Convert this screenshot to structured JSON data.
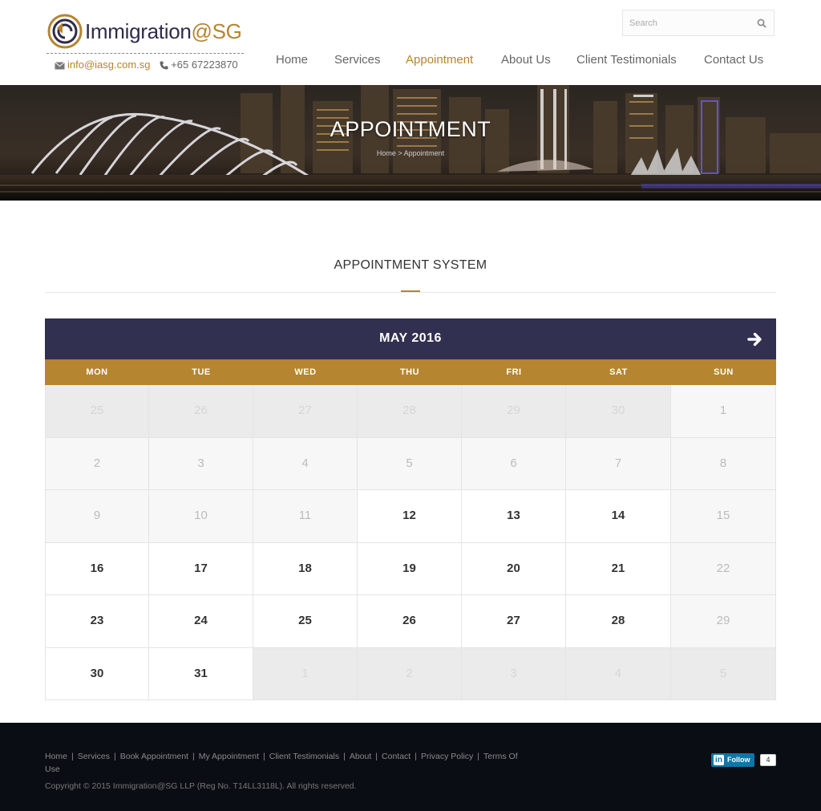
{
  "brand": {
    "name_main": "Immigration",
    "name_at": "@",
    "name_sg": "SG",
    "email": "info@iasg.com.sg",
    "phone": "+65 67223870"
  },
  "search": {
    "placeholder": "Search"
  },
  "nav": {
    "items": [
      {
        "label": "Home",
        "active": false
      },
      {
        "label": "Services",
        "active": false
      },
      {
        "label": "Appointment",
        "active": true
      },
      {
        "label": "About Us",
        "active": false
      },
      {
        "label": "Client Testimonials",
        "active": false
      },
      {
        "label": "Contact Us",
        "active": false
      }
    ]
  },
  "banner": {
    "title": "APPOINTMENT",
    "breadcrumb": "Home > Appointment"
  },
  "section": {
    "title": "APPOINTMENT SYSTEM"
  },
  "calendar": {
    "month_label": "MAY 2016",
    "weekdays": [
      "MON",
      "TUE",
      "WED",
      "THU",
      "FRI",
      "SAT",
      "SUN"
    ],
    "weeks": [
      [
        {
          "d": "25",
          "s": "other"
        },
        {
          "d": "26",
          "s": "other"
        },
        {
          "d": "27",
          "s": "other"
        },
        {
          "d": "28",
          "s": "other"
        },
        {
          "d": "29",
          "s": "other"
        },
        {
          "d": "30",
          "s": "other"
        },
        {
          "d": "1",
          "s": "past"
        }
      ],
      [
        {
          "d": "2",
          "s": "past"
        },
        {
          "d": "3",
          "s": "past"
        },
        {
          "d": "4",
          "s": "past"
        },
        {
          "d": "5",
          "s": "past"
        },
        {
          "d": "6",
          "s": "past"
        },
        {
          "d": "7",
          "s": "past"
        },
        {
          "d": "8",
          "s": "past"
        }
      ],
      [
        {
          "d": "9",
          "s": "past"
        },
        {
          "d": "10",
          "s": "past"
        },
        {
          "d": "11",
          "s": "past"
        },
        {
          "d": "12",
          "s": "avail"
        },
        {
          "d": "13",
          "s": "avail"
        },
        {
          "d": "14",
          "s": "avail"
        },
        {
          "d": "15",
          "s": "past"
        }
      ],
      [
        {
          "d": "16",
          "s": "avail"
        },
        {
          "d": "17",
          "s": "avail"
        },
        {
          "d": "18",
          "s": "avail"
        },
        {
          "d": "19",
          "s": "avail"
        },
        {
          "d": "20",
          "s": "avail"
        },
        {
          "d": "21",
          "s": "avail"
        },
        {
          "d": "22",
          "s": "past"
        }
      ],
      [
        {
          "d": "23",
          "s": "avail"
        },
        {
          "d": "24",
          "s": "avail"
        },
        {
          "d": "25",
          "s": "avail"
        },
        {
          "d": "26",
          "s": "avail"
        },
        {
          "d": "27",
          "s": "avail"
        },
        {
          "d": "28",
          "s": "avail"
        },
        {
          "d": "29",
          "s": "past"
        }
      ],
      [
        {
          "d": "30",
          "s": "avail"
        },
        {
          "d": "31",
          "s": "avail"
        },
        {
          "d": "1",
          "s": "other"
        },
        {
          "d": "2",
          "s": "other"
        },
        {
          "d": "3",
          "s": "other"
        },
        {
          "d": "4",
          "s": "other"
        },
        {
          "d": "5",
          "s": "other"
        }
      ]
    ]
  },
  "footer": {
    "links": [
      "Home",
      "Services",
      "Book Appointment",
      "My Appointment",
      "Client Testimonials",
      "About",
      "Contact",
      "Privacy Policy",
      "Terms Of Use"
    ],
    "copyright": "Copyright © 2015 Immigration@SG LLP (Reg No. T14LL3118L). All rights reserved.",
    "linkedin_label": "Follow",
    "linkedin_count": "4"
  },
  "colors": {
    "accent_gold": "#b5852f",
    "calendar_header": "#313050",
    "footer_bg": "#0b0d14"
  },
  "icons": {
    "search": "search-icon",
    "email": "envelope-icon",
    "phone": "phone-icon",
    "next_month": "arrow-right-icon",
    "logo": "return-arrow-logo"
  }
}
